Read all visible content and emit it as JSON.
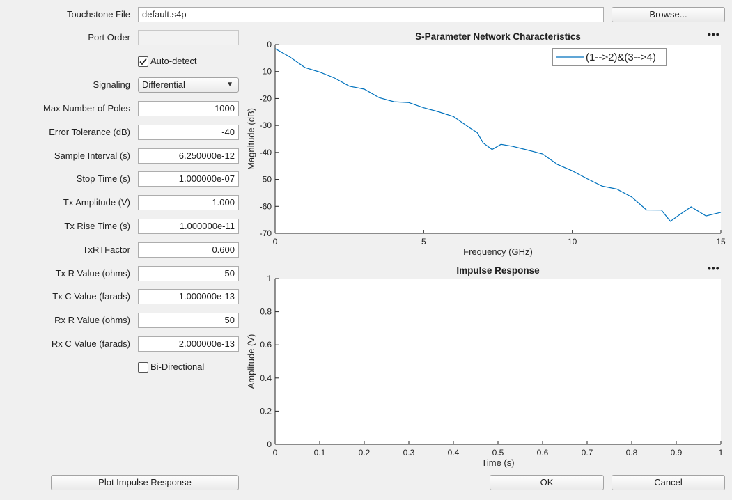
{
  "form": {
    "touchstone_label": "Touchstone File",
    "touchstone_value": "default.s4p",
    "browse_label": "Browse...",
    "port_order_label": "Port Order",
    "port_order_value": "",
    "auto_detect_label": "Auto-detect",
    "auto_detect_checked": true,
    "signaling_label": "Signaling",
    "signaling_value": "Differential",
    "fields": [
      {
        "label": "Max Number of Poles",
        "value": "1000"
      },
      {
        "label": "Error Tolerance (dB)",
        "value": "-40"
      },
      {
        "label": "Sample Interval (s)",
        "value": "6.250000e-12"
      },
      {
        "label": "Stop Time (s)",
        "value": "1.000000e-07"
      },
      {
        "label": "Tx Amplitude (V)",
        "value": "1.000"
      },
      {
        "label": "Tx Rise Time (s)",
        "value": "1.000000e-11"
      },
      {
        "label": "TxRTFactor",
        "value": "0.600"
      },
      {
        "label": "Tx R Value (ohms)",
        "value": "50"
      },
      {
        "label": "Tx C Value (farads)",
        "value": "1.000000e-13"
      },
      {
        "label": "Rx R Value (ohms)",
        "value": "50"
      },
      {
        "label": "Rx C Value (farads)",
        "value": "2.000000e-13"
      }
    ],
    "bidirectional_label": "Bi-Directional",
    "bidirectional_checked": false,
    "plot_button_label": "Plot Impulse Response",
    "ok_label": "OK",
    "cancel_label": "Cancel",
    "more_glyph": "•••"
  },
  "chart_data": [
    {
      "type": "line",
      "title": "S-Parameter Network Characteristics",
      "xlabel": "Frequency (GHz)",
      "ylabel": "Magnitude (dB)",
      "xlim": [
        0,
        15
      ],
      "ylim": [
        -70,
        0
      ],
      "xticks": [
        0,
        5,
        10,
        15
      ],
      "yticks": [
        0,
        -10,
        -20,
        -30,
        -40,
        -50,
        -60,
        -70
      ],
      "legend": "top-right",
      "series": [
        {
          "name": "(1-->2)&(3-->4)",
          "color": "#0072bd",
          "x": [
            0,
            0.5,
            1,
            1.5,
            2,
            2.5,
            3,
            3.5,
            4,
            4.5,
            5,
            5.5,
            6,
            6.5,
            6.8,
            7,
            7.3,
            7.6,
            8,
            8.5,
            9,
            9.5,
            10,
            10.5,
            11,
            11.5,
            12,
            12.5,
            13,
            13.3,
            13.6,
            14,
            14.5,
            15
          ],
          "y": [
            -1.5,
            -5,
            -8,
            -10.5,
            -12.5,
            -15,
            -17,
            -19.5,
            -21,
            -22,
            -23,
            -25,
            -27,
            -30,
            -33,
            -36.5,
            -38.5,
            -37.5,
            -37.5,
            -39,
            -41,
            -44,
            -47,
            -50,
            -52,
            -54,
            -56.5,
            -61,
            -63,
            -64.5,
            -63,
            -61.5,
            -62,
            -63
          ]
        }
      ]
    },
    {
      "type": "line",
      "title": "Impulse Response",
      "xlabel": "Time (s)",
      "ylabel": "Amplitude (V)",
      "xlim": [
        0,
        1
      ],
      "ylim": [
        0,
        1
      ],
      "xticks": [
        0,
        0.1,
        0.2,
        0.3,
        0.4,
        0.5,
        0.6,
        0.7,
        0.8,
        0.9,
        1
      ],
      "yticks": [
        0,
        0.2,
        0.4,
        0.6,
        0.8,
        1
      ],
      "series": []
    }
  ]
}
